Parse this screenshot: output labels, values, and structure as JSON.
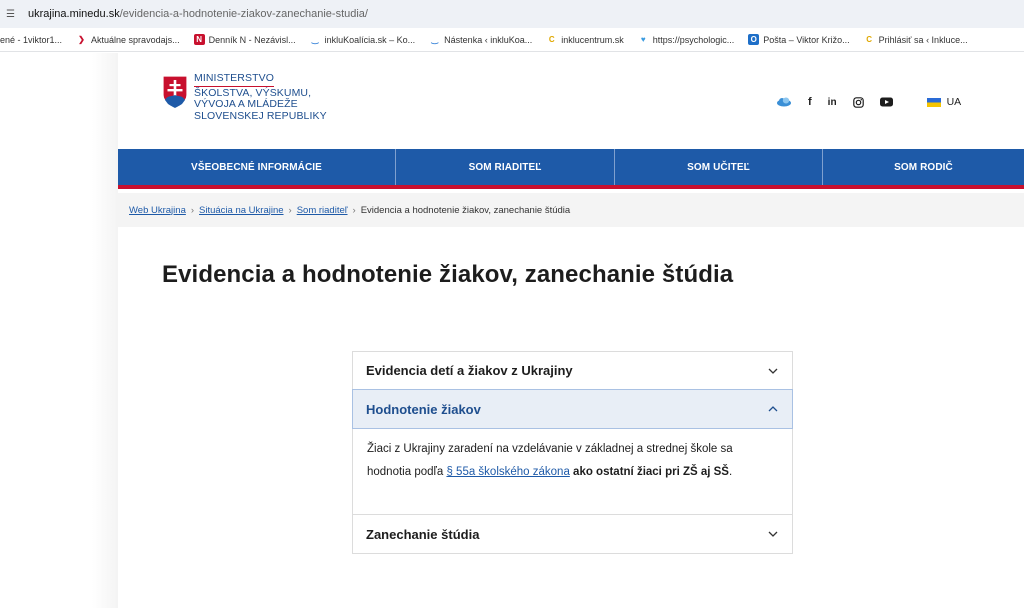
{
  "browser": {
    "url_domain": "ukrajina.minedu.sk",
    "url_path": "/evidencia-a-hodnotenie-ziakov-zanechanie-studia/",
    "bookmarks": [
      "ené - 1viktor1...",
      "Aktuálne spravodajs...",
      "Denník N - Nezávisl...",
      "inkluKoalícia.sk – Ko...",
      "Nástenka ‹ inkluKoa...",
      "inklucentrum.sk",
      "https://psychologic...",
      "Pošta – Viktor Križo...",
      "Prihlásiť sa ‹ Inkluce..."
    ]
  },
  "logo": {
    "line1": "MINISTERSTVO",
    "line2": "ŠKOLSTVA, VÝSKUMU,",
    "line3": "VÝVOJA A MLÁDEŽE",
    "line4": "SLOVENSKEJ REPUBLIKY"
  },
  "social": {
    "icons": [
      "cloud-icon",
      "facebook-icon",
      "linkedin-icon",
      "instagram-icon",
      "youtube-icon"
    ],
    "facebook": "f",
    "linkedin": "in",
    "language": "UA"
  },
  "nav": {
    "items": [
      "VŠEOBECNÉ INFORMÁCIE",
      "SOM RIADITEĽ",
      "SOM UČITEĽ",
      "SOM RODIČ"
    ]
  },
  "breadcrumb": {
    "links": [
      "Web Ukrajina",
      "Situácia na Ukrajine",
      "Som riaditeľ"
    ],
    "current": "Evidencia a hodnotenie žiakov, zanechanie štúdia"
  },
  "page": {
    "title": "Evidencia a hodnotenie žiakov, zanechanie štúdia"
  },
  "accordion": {
    "items": [
      {
        "label": "Evidencia detí a žiakov z Ukrajiny",
        "open": false
      },
      {
        "label": "Hodnotenie žiakov",
        "open": true
      },
      {
        "label": "Zanechanie štúdia",
        "open": false
      }
    ],
    "body": {
      "text1": "Žiaci z Ukrajiny zaradení na vzdelávanie v základnej a strednej škole sa hodnotia podľa ",
      "link": "§ 55a školského zákona",
      "text2": " ",
      "bold": "ako ostatní žiaci pri ZŠ aj SŠ",
      "text3": "."
    }
  },
  "colors": {
    "brand_blue": "#1e5aa8",
    "brand_red": "#c8102e",
    "open_bg": "#e8eef6"
  }
}
